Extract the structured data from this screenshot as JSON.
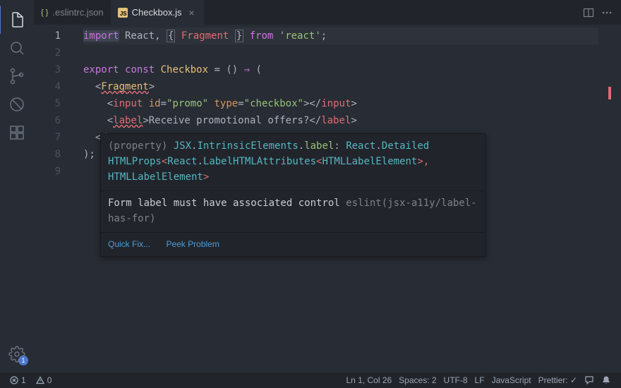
{
  "tabs": {
    "inactive": {
      "label": ".eslintrc.json"
    },
    "active": {
      "label": "Checkbox.js"
    }
  },
  "gear_badge": "1",
  "lines": [
    "1",
    "2",
    "3",
    "4",
    "5",
    "6",
    "7",
    "8",
    "9"
  ],
  "current_line_index": 0,
  "code": {
    "l1": {
      "t0": "import",
      "t1": " React, ",
      "t2": "{",
      "t3": " Fragment ",
      "t4": "}",
      "t5": " from ",
      "t6": "'react'",
      "t7": ";"
    },
    "l3": {
      "t0": "export",
      "t1": " ",
      "t2": "const",
      "t3": " ",
      "t4": "Checkbox",
      "t5": " = () ",
      "t6": "⇒",
      "t7": " ("
    },
    "l4": {
      "t0": "  <",
      "t1": "Fragment",
      "t2": ">"
    },
    "l5": {
      "t0": "    <",
      "t1": "input",
      "t2": " ",
      "t3": "id",
      "t4": "=",
      "t5": "\"promo\"",
      "t6": " ",
      "t7": "type",
      "t8": "=",
      "t9": "\"checkbox\"",
      "t10": "></",
      "t11": "input",
      "t12": ">"
    },
    "l6": {
      "t0": "    <",
      "t1": "label",
      "t2": ">",
      "t3": "Receive promotional offers?",
      "t4": "</",
      "t5": "label",
      "t6": ">"
    },
    "l7": {
      "t0": "  </"
    },
    "l8": {
      "t0": ");"
    }
  },
  "hover": {
    "sig": {
      "t0": "(property) ",
      "t1": "JSX",
      "t2": ".",
      "t3": "IntrinsicElements",
      "t4": ".",
      "t5": "label",
      "t6": ": ",
      "t7": "React",
      "t8": ".",
      "t9": "Detailed",
      "t10": "HTMLProps",
      "t11": "<",
      "t12": "React",
      "t13": ".",
      "t14": "LabelHTMLAttributes",
      "t15": "<",
      "t16": "HTMLLabelElement",
      "t17": ">,",
      "t18": " HTMLLabelElement",
      "t19": ">"
    },
    "lint_msg": "Form label must have associated control ",
    "lint_src": "eslint(jsx-a11y/label-has-for)",
    "quickfix": "Quick Fix...",
    "peek": "Peek Problem"
  },
  "status": {
    "errors": "1",
    "warnings": "0",
    "cursor": "Ln 1, Col 26",
    "spaces": "Spaces: 2",
    "encoding": "UTF-8",
    "eol": "LF",
    "lang": "JavaScript",
    "prettier": "Prettier: ✓"
  }
}
